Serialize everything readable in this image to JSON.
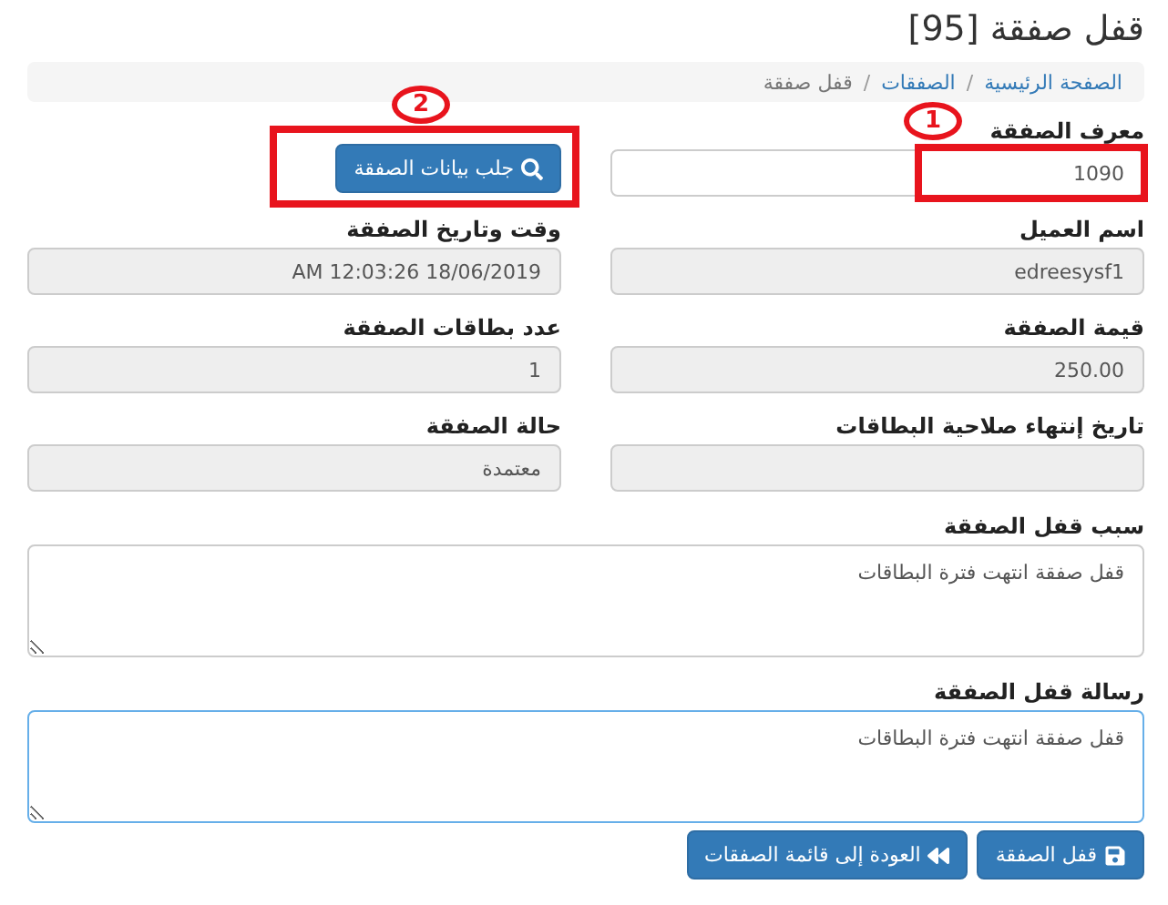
{
  "title": "قفل صفقة [95]",
  "breadcrumb_separator": "/",
  "breadcrumb": [
    {
      "label": "الصفحة الرئيسية",
      "link": true
    },
    {
      "label": "الصفقات",
      "link": true
    },
    {
      "label": "قفل صفقة",
      "link": false
    }
  ],
  "grid": [
    {
      "kind": "input",
      "label": "معرف الصفقة",
      "value": "1090",
      "disabled": false,
      "annotation": "1"
    },
    {
      "kind": "button",
      "label": "جلب بيانات الصفقة",
      "annotation": "2"
    },
    {
      "kind": "input",
      "label": "اسم العميل",
      "value": "edreesysf1",
      "disabled": true
    },
    {
      "kind": "input",
      "label": "وقت وتاريخ الصفقة",
      "value": "AM 12:03:26 18/06/2019",
      "disabled": true
    },
    {
      "kind": "input",
      "label": "قيمة الصفقة",
      "value": "250.00",
      "disabled": true
    },
    {
      "kind": "input",
      "label": "عدد بطاقات الصفقة",
      "value": "1",
      "disabled": true
    },
    {
      "kind": "input",
      "label": "تاريخ إنتهاء صلاحية البطاقات",
      "disabled": true
    },
    {
      "kind": "input",
      "label": "حالة الصفقة",
      "value": "معتمدة",
      "disabled": true
    }
  ],
  "textareas": [
    {
      "label": "سبب قفل الصفقة",
      "value": "قفل صفقة انتهت فترة البطاقات",
      "focused": false
    },
    {
      "label": "رسالة قفل الصفقة",
      "value": "قفل صفقة انتهت فترة البطاقات",
      "focused": true
    }
  ],
  "actions": [
    {
      "kind": "save",
      "label": "قفل الصفقة"
    },
    {
      "kind": "back",
      "label": "العودة إلى قائمة الصفقات"
    }
  ]
}
